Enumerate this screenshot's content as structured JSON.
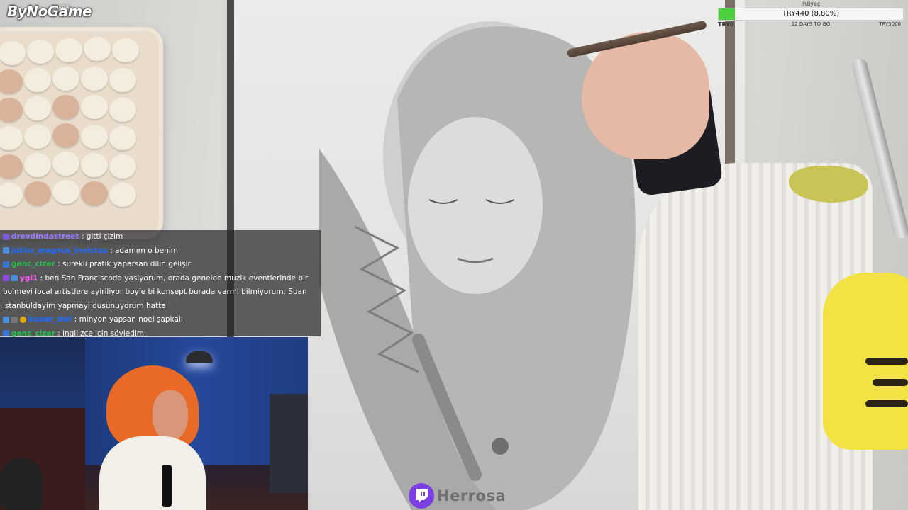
{
  "branding": {
    "logo_text": "ByNoGame",
    "logo_sub": ".com"
  },
  "goal": {
    "title": "ihtiyaç",
    "value_label": "TRY440 (8.80%)",
    "progress_fraction": 0.088,
    "start_label": "TRY0",
    "days_label": "12 DAYS TO GO",
    "target_label": "TRY5000",
    "fill_color": "#4ccf3f"
  },
  "chat": {
    "messages": [
      {
        "user": "drevdindastreet",
        "text": ": gitti çizim",
        "color": "#9a7bff"
      },
      {
        "user": "julius_magnus_invictus",
        "text": ": adamım o benim",
        "color": "#1e6bff"
      },
      {
        "user": "genc_cizer",
        "text": ": sürekli pratik yaparsan dilin gelişir",
        "color": "#29c44d"
      },
      {
        "user": "ygl1",
        "text": ": ben San Franciscoda yasiyorum, orada genelde muzik eventlerinde bir bolmeyi local artistlere ayiriliyor boyle bi konsept burada varmi bilmiyorum. Suan istanbuldayim yapmayi dusunuyorum hatta",
        "color": "#ff5cf3"
      },
      {
        "user": "kusan_dwl",
        "text": ": minyon yapsan noel şapkalı",
        "color": "#1e6bff"
      },
      {
        "user": "genc_cizer",
        "text": ": ingilizce için söyledim",
        "color": "#29c44d"
      }
    ]
  },
  "watermark": {
    "name": "Herrosa",
    "icon": "twitch-icon",
    "color": "#7b3fe4"
  }
}
